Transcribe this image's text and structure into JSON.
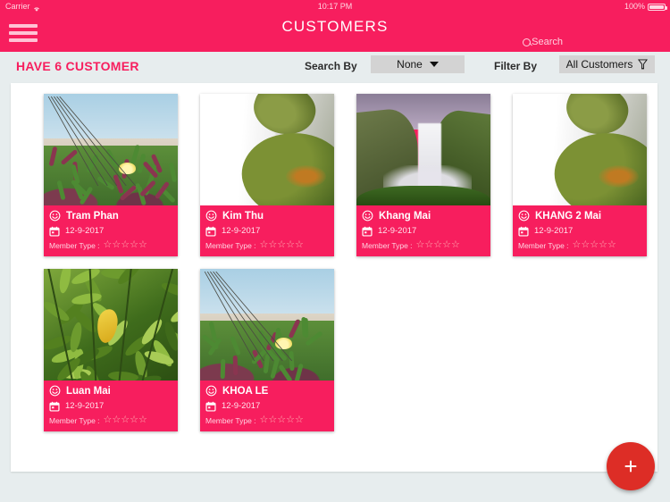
{
  "status_bar": {
    "carrier": "Carrier",
    "wifi_icon": "wifi-icon",
    "time": "10:17 PM",
    "battery_percent": "100%",
    "battery_icon": "battery-icon"
  },
  "navbar": {
    "menu_icon": "hamburger-menu-icon",
    "title": "CUSTOMERS",
    "search_icon": "search-icon",
    "search_label": "Search",
    "background_color": "#f71e5e"
  },
  "filter_bar": {
    "count_text": "HAVE 6 CUSTOMER",
    "search_by_label": "Search By",
    "search_by_value": "None",
    "search_by_caret_icon": "chevron-down-icon",
    "filter_by_label": "Filter By",
    "filter_by_value": "All Customers",
    "filter_icon": "funnel-filter-icon"
  },
  "customers": [
    {
      "name": "Tram Phan",
      "date": "12-9-2017",
      "member_type_label": "Member Type :",
      "stars": 5,
      "stars_filled": 0,
      "photo": "dune-flower-photo",
      "smiley_icon": "smiley-face-icon",
      "calendar_icon": "calendar-icon"
    },
    {
      "name": "Kim Thu",
      "date": "12-9-2017",
      "member_type_label": "Member Type :",
      "stars": 5,
      "stars_filled": 0,
      "photo": "mossy-waterfall-photo",
      "smiley_icon": "smiley-face-icon",
      "calendar_icon": "calendar-icon"
    },
    {
      "name": "Khang Mai",
      "date": "12-9-2017",
      "member_type_label": "Member Type :",
      "stars": 5,
      "stars_filled": 0,
      "photo": "big-waterfall-photo",
      "smiley_icon": "smiley-face-icon",
      "calendar_icon": "calendar-icon"
    },
    {
      "name": "KHANG 2 Mai",
      "date": "12-9-2017",
      "member_type_label": "Member Type :",
      "stars": 5,
      "stars_filled": 0,
      "photo": "mossy-waterfall-photo",
      "smiley_icon": "smiley-face-icon",
      "calendar_icon": "calendar-icon"
    },
    {
      "name": "Luan Mai",
      "date": "12-9-2017",
      "member_type_label": "Member Type :",
      "stars": 5,
      "stars_filled": 0,
      "photo": "yellow-leaf-photo",
      "smiley_icon": "smiley-face-icon",
      "calendar_icon": "calendar-icon"
    },
    {
      "name": "KHOA LE",
      "date": "12-9-2017",
      "member_type_label": "Member Type :",
      "stars": 5,
      "stars_filled": 0,
      "photo": "dune-flower-photo",
      "smiley_icon": "smiley-face-icon",
      "calendar_icon": "calendar-icon"
    }
  ],
  "fab": {
    "icon": "plus-icon",
    "color": "#dd2d26"
  },
  "star_glyph": "☆",
  "colors": {
    "accent_pink": "#f71e5e",
    "page_background": "#e7edee",
    "panel": "#ffffff",
    "fab_red": "#dd2d26"
  }
}
